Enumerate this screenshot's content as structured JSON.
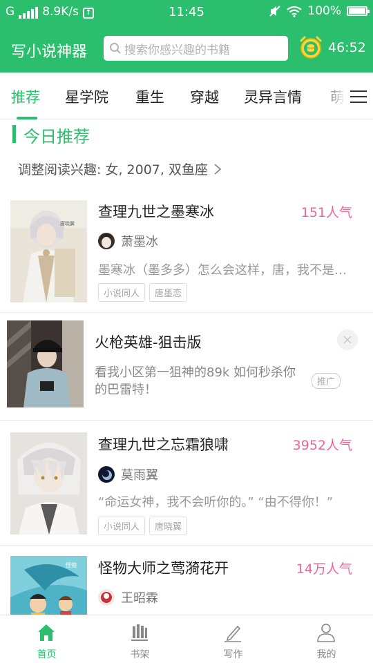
{
  "status_bar": {
    "network_type": "G",
    "net_speed": "8.9K/s",
    "time": "11:45",
    "battery": "100%"
  },
  "header": {
    "app_title": "写小说神器",
    "search_placeholder": "搜索你感兴趣的书籍",
    "timer": "46:52"
  },
  "tabs": [
    {
      "label": "推荐",
      "active": true
    },
    {
      "label": "星学院"
    },
    {
      "label": "重生"
    },
    {
      "label": "穿越"
    },
    {
      "label": "灵异言情"
    },
    {
      "label": "萌"
    }
  ],
  "section": {
    "title": "今日推荐",
    "interest_line": "调整阅读兴趣: 女, 2007, 双鱼座"
  },
  "books": [
    {
      "title": "查理九世之墨寒冰",
      "popularity": "151人气",
      "author": "萧墨冰",
      "description": "墨寒冰（墨多多）怎么会这样，唐，我不是故意的",
      "tags": [
        "小说同人",
        "唐墨恋"
      ]
    },
    {
      "title": "查理九世之忘霜狼啸",
      "popularity": "3952人气",
      "author": "莫雨翼",
      "description": "“命运女神，我不会听你的。” “由不得你！”",
      "tags": [
        "小说同人",
        "唐晓翼"
      ]
    },
    {
      "title": "怪物大师之莺漪花开",
      "popularity": "14万人气",
      "author": "王昭霖",
      "description": "",
      "tags": []
    }
  ],
  "ad": {
    "title": "火枪英雄-狙击版",
    "description": "看我小区第一狙神的89k 如何秒杀你的巴雷特！",
    "badge": "推广"
  },
  "bottom_nav": [
    {
      "label": "首页",
      "icon": "home-icon",
      "active": true
    },
    {
      "label": "书架",
      "icon": "bookshelf-icon"
    },
    {
      "label": "写作",
      "icon": "pen-icon"
    },
    {
      "label": "我的",
      "icon": "user-icon"
    }
  ],
  "colors": {
    "brand_green": "#2bbe6d",
    "popularity_pink": "#e8679a"
  }
}
